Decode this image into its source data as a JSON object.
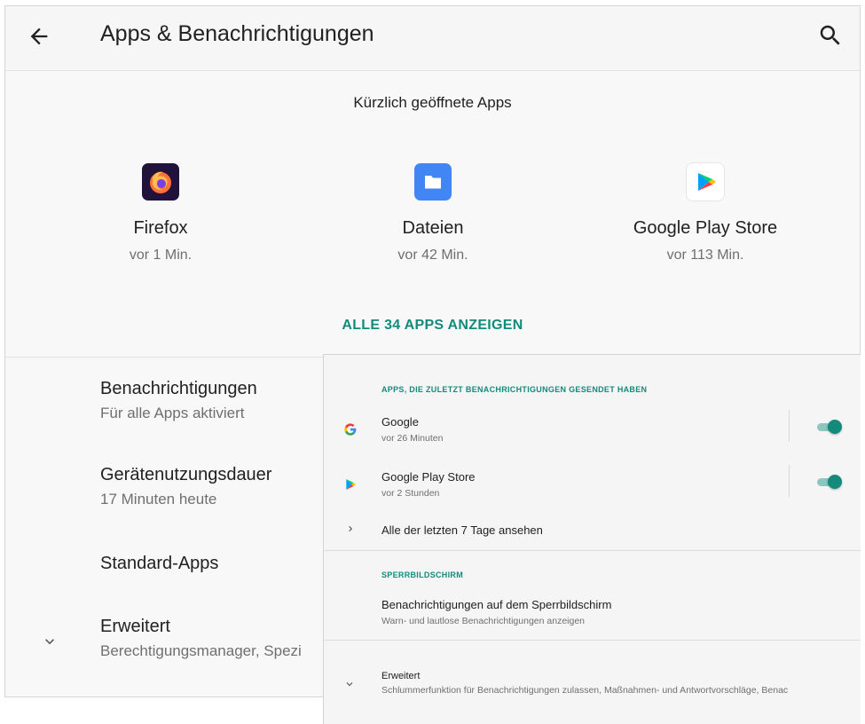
{
  "header": {
    "title": "Apps & Benachrichtigungen"
  },
  "recent": {
    "heading": "Kürzlich geöffnete Apps",
    "apps": [
      {
        "name": "Firefox",
        "time": "vor 1 Min.",
        "icon": "firefox-icon"
      },
      {
        "name": "Dateien",
        "time": "vor 42 Min.",
        "icon": "files-icon"
      },
      {
        "name": "Google Play Store",
        "time": "vor 113 Min.",
        "icon": "play-store-icon"
      }
    ],
    "all_apps_label": "ALLE 34 APPS ANZEIGEN"
  },
  "settings": {
    "items": [
      {
        "title": "Benachrichtigungen",
        "subtitle": "Für alle Apps aktiviert"
      },
      {
        "title": "Gerätenutzungsdauer",
        "subtitle": "17 Minuten heute"
      },
      {
        "title": "Standard-Apps",
        "subtitle": ""
      },
      {
        "title": "Erweitert",
        "subtitle": "Berechtigungsmanager, Spezi"
      }
    ]
  },
  "notifications": {
    "recent_label": "APPS, DIE ZULETZT BENACHRICHTIGUNGEN GESENDET HABEN",
    "apps": [
      {
        "name": "Google",
        "time": "vor 26 Minuten",
        "enabled": true,
        "icon": "google-icon"
      },
      {
        "name": "Google Play Store",
        "time": "vor 2 Stunden",
        "enabled": true,
        "icon": "play-store-icon"
      }
    ],
    "see_all_label": "Alle der letzten 7 Tage ansehen",
    "lockscreen_label": "SPERRBILDSCHIRM",
    "lockscreen_title": "Benachrichtigungen auf dem Sperrbildschirm",
    "lockscreen_sub": "Warn- und lautlose Benachrichtigungen anzeigen",
    "advanced_title": "Erweitert",
    "advanced_sub": "Schlummerfunktion für Benachrichtigungen zulassen, Maßnahmen- und Antwortvorschläge, Benac"
  },
  "colors": {
    "accent": "#138a7c",
    "toggle_track": "#8bc7bf",
    "files_blue": "#4285f4",
    "firefox_purple": "#20123a",
    "firefox_orange": "#ff7139"
  }
}
